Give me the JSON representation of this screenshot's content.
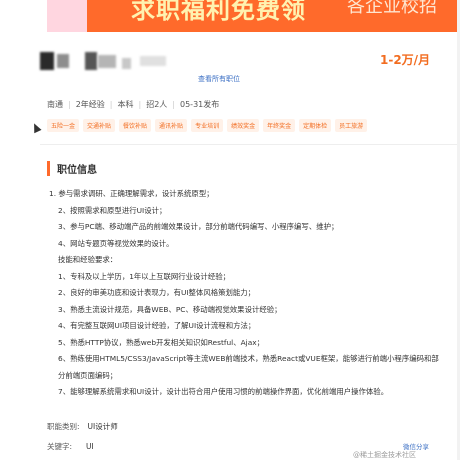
{
  "banner": {
    "headline": "求职福利免费领",
    "sub": "各企业校招"
  },
  "job": {
    "salary": "1-2万/月",
    "view_all_label": "查看所有职位"
  },
  "meta": [
    "南通",
    "2年经验",
    "本科",
    "招2人",
    "05-31发布"
  ],
  "benefits": [
    "五险一金",
    "交通补贴",
    "餐饮补贴",
    "通讯补贴",
    "专业培训",
    "绩效奖金",
    "年终奖金",
    "定期体检",
    "员工旅游"
  ],
  "section": {
    "title": "职位信息"
  },
  "description": [
    "1. 参与需求调研、正确理解需求，设计系统原型；",
    "2、按照需求和原型进行UI设计；",
    "3、参与PC端、移动端产品的前端效果设计，部分前端代码编写、小程序编写、维护；",
    "4、网站专题页等视觉效果的设计。",
    "技能和经验要求：",
    "1、专科及以上学历，1年以上互联网行业设计经验；",
    "2、良好的审美功底和设计表现力，有UI整体风格策划能力；",
    "3、熟悉主流设计规范，具备WEB、PC、移动端视觉效果设计经验；",
    "4、有完整互联网UI项目设计经验，了解UI设计流程和方法；",
    "5、熟悉HTTP协议，熟悉web开发相关知识如Restful、Ajax；",
    "6、熟练使用HTML5/CSS3/JavaScript等主流WEB前端技术，熟悉React或VUE框架，能够进行前端小程序编码和部分前端页面编码；",
    "7、能够理解系统需求和UI设计，设计出符合用户使用习惯的前端操作界面，优化前端用户操作体验。"
  ],
  "info": {
    "category_label": "职能类别:",
    "category_value": "UI设计师",
    "keyword_label": "关键字:",
    "keyword_value": "UI"
  },
  "share_label": "微信分享",
  "watermark": "@稀土掘金技术社区"
}
